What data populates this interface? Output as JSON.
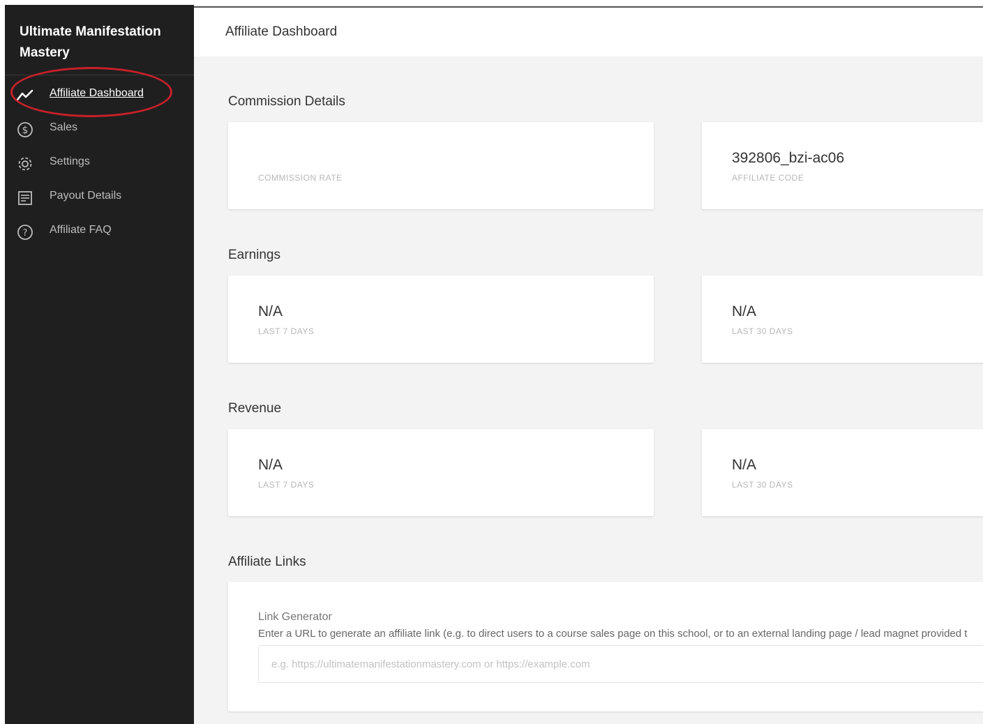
{
  "sidebar": {
    "brand": "Ultimate Manifestation Mastery",
    "items": [
      {
        "label": "Affiliate Dashboard",
        "icon": "chart-line-icon",
        "active": true
      },
      {
        "label": "Sales",
        "icon": "dollar-circle-icon"
      },
      {
        "label": "Settings",
        "icon": "gear-icon"
      },
      {
        "label": "Payout Details",
        "icon": "document-list-icon"
      },
      {
        "label": "Affiliate FAQ",
        "icon": "question-circle-icon"
      }
    ]
  },
  "header": {
    "title": "Affiliate Dashboard"
  },
  "commission": {
    "title": "Commission Details",
    "rate_value": "",
    "rate_caption": "COMMISSION RATE",
    "code_value": "392806_bzi-ac06",
    "code_caption": "AFFILIATE CODE"
  },
  "earnings": {
    "title": "Earnings",
    "last7_value": "N/A",
    "last7_caption": "LAST 7 DAYS",
    "last30_value": "N/A",
    "last30_caption": "LAST 30 DAYS"
  },
  "revenue": {
    "title": "Revenue",
    "last7_value": "N/A",
    "last7_caption": "LAST 7 DAYS",
    "last30_value": "N/A",
    "last30_caption": "LAST 30 DAYS"
  },
  "links": {
    "title": "Affiliate Links",
    "generator_title": "Link Generator",
    "generator_desc": "Enter a URL to generate an affiliate link (e.g. to direct users to a course sales page on this school, or to an external landing page / lead magnet provided t",
    "input_value": "",
    "input_placeholder": "e.g. https://ultimatemanifestationmastery.com or https://example.com"
  },
  "colors": {
    "sidebar_bg": "#1f1f1f",
    "main_bg": "#f3f3f4",
    "highlight": "#c8202a"
  }
}
